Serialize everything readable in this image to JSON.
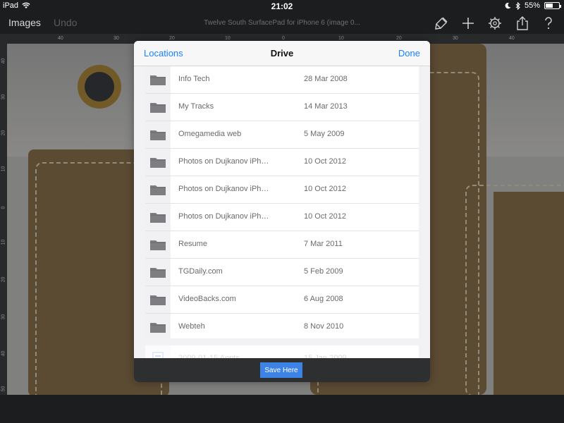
{
  "status_bar": {
    "device": "iPad",
    "time": "21:02",
    "battery_percent": "55%",
    "battery_level": 0.55
  },
  "toolbar": {
    "images_label": "Images",
    "undo_label": "Undo",
    "document_title": "Twelve South SurfacePad for iPhone 6 (image 0...",
    "tools": [
      "paint-brush-icon",
      "plus-icon",
      "gear-icon",
      "share-icon",
      "help-icon"
    ]
  },
  "rulers": {
    "top_labels": [
      "40",
      "30",
      "20",
      "10",
      "0",
      "10",
      "20",
      "30",
      "40"
    ],
    "left_labels": [
      "40",
      "30",
      "20",
      "10",
      "0",
      "10",
      "20",
      "30",
      "40",
      "50"
    ]
  },
  "dialog": {
    "left_button": "Locations",
    "title": "Drive",
    "right_button": "Done",
    "files": [
      {
        "name": "Info Tech",
        "date": "28 Mar 2008",
        "icon": "folder-icon"
      },
      {
        "name": "My Tracks",
        "date": "14 Mar 2013",
        "icon": "folder-icon"
      },
      {
        "name": "Omegamedia web",
        "date": "5 May 2009",
        "icon": "folder-icon"
      },
      {
        "name": "Photos on Dujkanov iPh…",
        "date": "10 Oct 2012",
        "icon": "folder-icon"
      },
      {
        "name": "Photos on Dujkanov iPh…",
        "date": "10 Oct 2012",
        "icon": "folder-icon"
      },
      {
        "name": "Photos on Dujkanov iPh…",
        "date": "10 Oct 2012",
        "icon": "folder-icon"
      },
      {
        "name": "Resume",
        "date": "7 Mar 2011",
        "icon": "folder-icon"
      },
      {
        "name": "TGDaily.com",
        "date": "5 Feb 2009",
        "icon": "folder-icon"
      },
      {
        "name": "VideoBacks.com",
        "date": "6 Aug 2008",
        "icon": "folder-icon"
      },
      {
        "name": "Webteh",
        "date": "8 Nov 2010",
        "icon": "folder-icon"
      }
    ],
    "partial_file": {
      "name": "2009-01-15 Appts",
      "date": "15 Jan 2009",
      "icon": "document-icon"
    },
    "save_button": "Save Here"
  },
  "colors": {
    "accent": "#1a82f7",
    "save_button": "#3d83e6",
    "chrome": "#1c1d1f"
  }
}
